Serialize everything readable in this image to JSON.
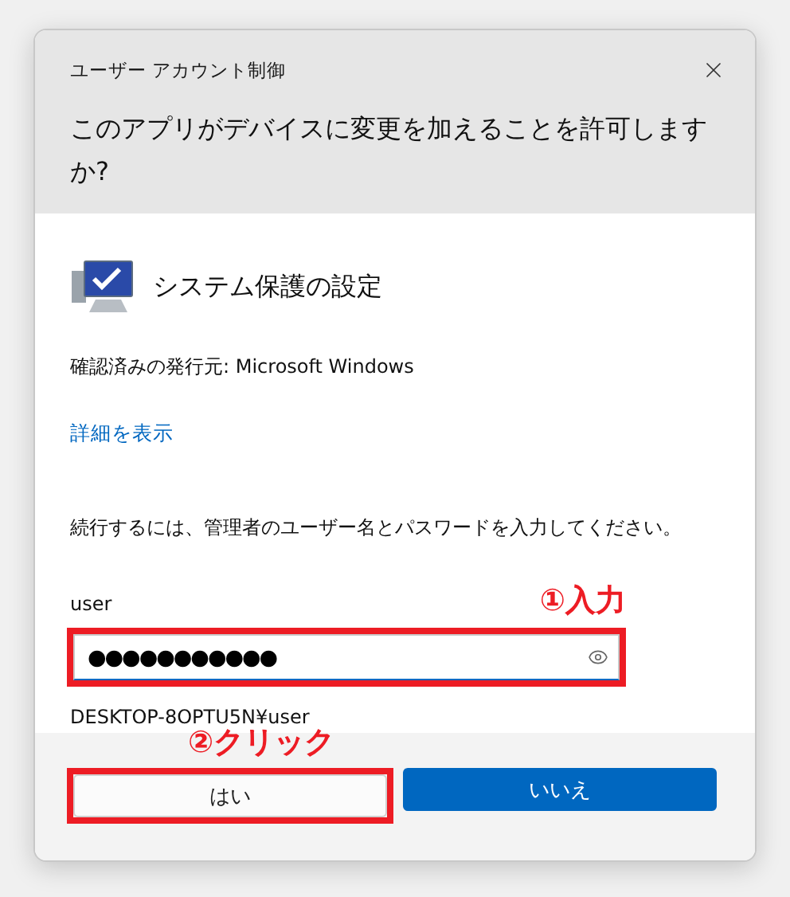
{
  "window": {
    "title": "ユーザー アカウント制御"
  },
  "question": "このアプリがデバイスに変更を加えることを許可しますか?",
  "app": {
    "name": "システム保護の設定"
  },
  "publisher": "確認済みの発行元: Microsoft Windows",
  "details_link": "詳細を表示",
  "instruction": "続行するには、管理者のユーザー名とパスワードを入力してください。",
  "username_label": "user",
  "password": {
    "value": "●●●●●●●●●●●",
    "highlighted": true,
    "annotation": "①入力"
  },
  "account": "DESKTOP-8OPTU5N¥user",
  "buttons": [
    {
      "label": "はい",
      "kind": "secondary",
      "highlighted": true,
      "annotation": "②クリック"
    },
    {
      "label": "いいえ",
      "kind": "primary",
      "highlighted": false
    }
  ]
}
